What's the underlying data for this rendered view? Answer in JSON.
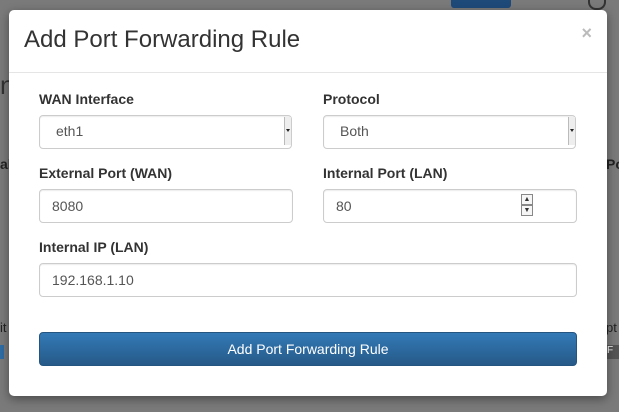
{
  "modal": {
    "title": "Add Port Forwarding Rule",
    "close_icon": "×"
  },
  "form": {
    "wan_interface": {
      "label": "WAN Interface",
      "value": "eth1"
    },
    "protocol": {
      "label": "Protocol",
      "value": "Both"
    },
    "external_port": {
      "label": "External Port (WAN)",
      "value": "8080"
    },
    "internal_port": {
      "label": "Internal Port (LAN)",
      "value": "80"
    },
    "internal_ip": {
      "label": "Internal IP (LAN)",
      "value": "192.168.1.10"
    },
    "submit_label": "Add Port Forwarding Rule"
  },
  "background": {
    "heading_fragment": "n",
    "col_left_fragment": "al",
    "col_right_fragment": "Po",
    "row_left_fragment": "it",
    "row_right_fragment": "pt",
    "badge_fragment": "F"
  },
  "colors": {
    "primary": "#337ab7",
    "overlay": "#7a7a7a"
  },
  "icons": {
    "close": "close-icon",
    "select_arrow": "chevron-down-icon",
    "spinner_up": "chevron-up-icon",
    "spinner_down": "chevron-down-icon"
  }
}
